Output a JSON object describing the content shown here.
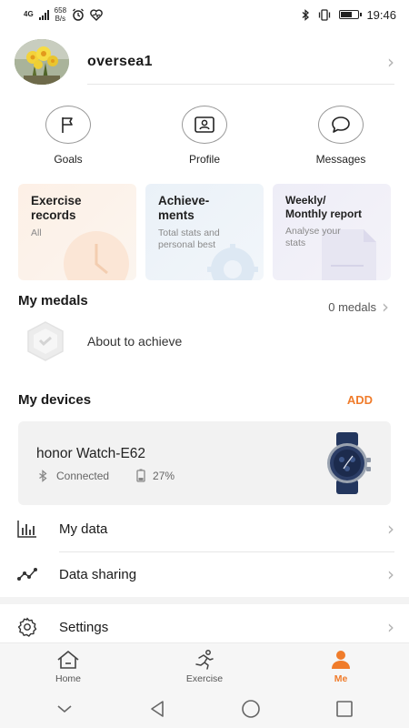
{
  "status_bar": {
    "network": "4G",
    "speed_value": "658",
    "speed_unit": "B/s",
    "time": "19:46",
    "battery_level": 0.6
  },
  "profile": {
    "name": "oversea1"
  },
  "quick_actions": [
    {
      "label": "Goals",
      "icon": "flag-icon"
    },
    {
      "label": "Profile",
      "icon": "id-card-icon"
    },
    {
      "label": "Messages",
      "icon": "chat-bubble-icon"
    }
  ],
  "cards": [
    {
      "title_line1": "Exercise",
      "title_line2": "records",
      "subtitle": "All"
    },
    {
      "title_line1": "Achieve-",
      "title_line2": "ments",
      "subtitle_line1": "Total stats and",
      "subtitle_line2": "personal best"
    },
    {
      "title_line1": "Weekly/",
      "title_line2": "Monthly report",
      "subtitle_line1": "Analyse your",
      "subtitle_line2": "stats"
    }
  ],
  "medals": {
    "title": "My medals",
    "count_label": "0 medals",
    "item_text": "About to achieve"
  },
  "devices": {
    "title": "My devices",
    "add_label": "ADD",
    "device": {
      "name": "honor Watch-E62",
      "connection": "Connected",
      "battery": "27%"
    }
  },
  "menu": [
    {
      "label": "My data",
      "icon": "bar-chart-icon"
    },
    {
      "label": "Data sharing",
      "icon": "share-graph-icon"
    },
    {
      "label": "Settings",
      "icon": "gear-icon"
    }
  ],
  "tabs": [
    {
      "label": "Home",
      "icon": "home-icon",
      "active": false
    },
    {
      "label": "Exercise",
      "icon": "runner-icon",
      "active": false
    },
    {
      "label": "Me",
      "icon": "person-icon",
      "active": true
    }
  ],
  "colors": {
    "accent": "#f07c2b",
    "text": "#1a1a1a",
    "muted": "#8a8a8a"
  }
}
